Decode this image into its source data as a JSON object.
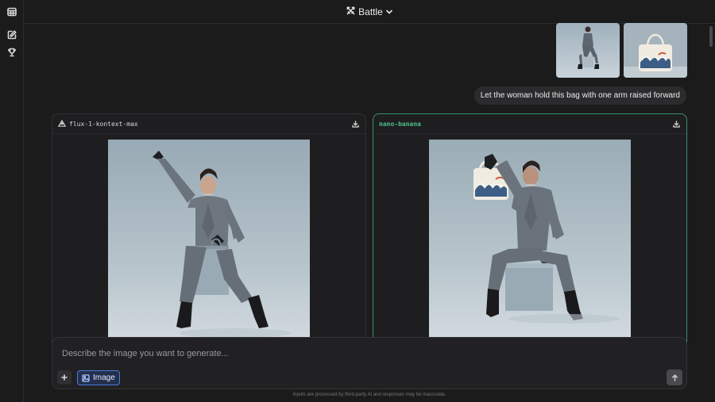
{
  "header": {
    "mode_label": "Battle",
    "mode_icon": "battle-swords-icon"
  },
  "sidebar": {
    "items": [
      {
        "icon": "table-grid-icon"
      },
      {
        "icon": "edit-note-icon"
      },
      {
        "icon": "trophy-icon"
      }
    ]
  },
  "conversation": {
    "user_message": {
      "attachments": [
        {
          "description": "woman seated on grey cube"
        },
        {
          "description": "white handbag with wave print"
        }
      ],
      "text": "Let the woman hold this bag with one arm raised forward"
    },
    "results": [
      {
        "model": "flux-1-kontext-max",
        "model_icon": "triangle-logo-icon",
        "winner": false
      },
      {
        "model": "nano-banana",
        "winner": true
      }
    ]
  },
  "composer": {
    "placeholder": "Describe the image you want to generate...",
    "image_label": "Image"
  },
  "footer": {
    "disclaimer": "Inputs are processed by third-party AI and responses may be inaccurate."
  },
  "colors": {
    "background": "#1b1b1c",
    "winner_accent": "#3c8f6c",
    "winner_text": "#4fbf8c",
    "image_button_border": "#4d7be0"
  }
}
